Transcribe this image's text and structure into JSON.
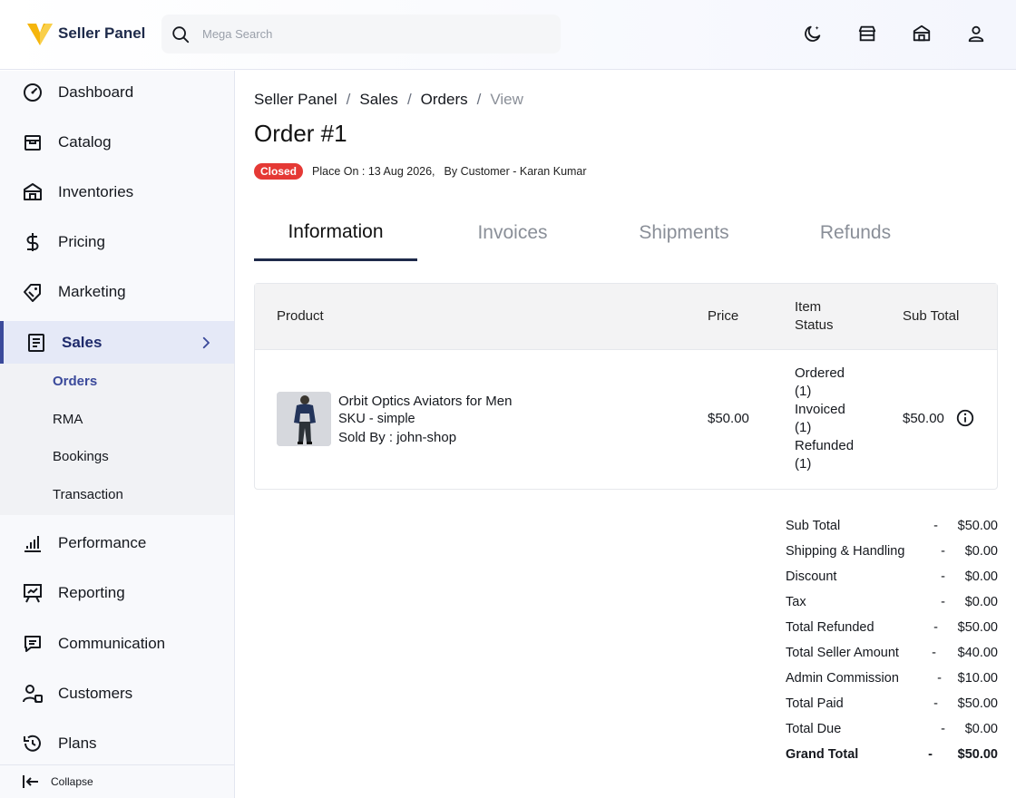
{
  "header": {
    "brand": "Seller Panel",
    "search_placeholder": "Mega Search"
  },
  "sidebar": {
    "items": [
      {
        "label": "Dashboard",
        "icon": "dashboard-icon"
      },
      {
        "label": "Catalog",
        "icon": "catalog-icon"
      },
      {
        "label": "Inventories",
        "icon": "inventories-icon"
      },
      {
        "label": "Pricing",
        "icon": "dollar-icon"
      },
      {
        "label": "Marketing",
        "icon": "tag-icon"
      },
      {
        "label": "Sales",
        "icon": "receipt-icon"
      },
      {
        "label": "Performance",
        "icon": "bar-chart-icon"
      },
      {
        "label": "Reporting",
        "icon": "presentation-icon"
      },
      {
        "label": "Communication",
        "icon": "message-icon"
      },
      {
        "label": "Customers",
        "icon": "customers-icon"
      },
      {
        "label": "Plans",
        "icon": "history-icon"
      }
    ],
    "sales_sub": [
      "Orders",
      "RMA",
      "Bookings",
      "Transaction"
    ],
    "collapse_label": "Collapse"
  },
  "breadcrumb": {
    "items": [
      "Seller Panel",
      "Sales",
      "Orders"
    ],
    "current": "View",
    "separator": "/"
  },
  "order": {
    "title": "Order #1",
    "status": "Closed",
    "placed": "Place On : 13 Aug 2026,",
    "customer": "By Customer - Karan Kumar"
  },
  "tabs": [
    "Information",
    "Invoices",
    "Shipments",
    "Refunds"
  ],
  "table": {
    "headers": {
      "product": "Product",
      "price": "Price",
      "item_status_1": "Item",
      "item_status_2": "Status",
      "subtotal": "Sub Total"
    },
    "rows": [
      {
        "name": "Orbit Optics Aviators for Men",
        "sku": "SKU - simple",
        "sold_by": "Sold By : john-shop",
        "price": "$50.00",
        "status": [
          "Ordered",
          "(1)",
          "Invoiced",
          "(1)",
          "Refunded",
          "(1)"
        ],
        "subtotal": "$50.00"
      }
    ]
  },
  "totals": [
    {
      "label": "Sub Total",
      "dash": "-",
      "value": "$50.00"
    },
    {
      "label": "Shipping & Handling",
      "dash": "-",
      "value": "$0.00"
    },
    {
      "label": "Discount",
      "dash": "-",
      "value": "$0.00"
    },
    {
      "label": "Tax",
      "dash": "-",
      "value": "$0.00"
    },
    {
      "label": "Total Refunded",
      "dash": "-",
      "value": "$50.00"
    },
    {
      "label": "Total Seller Amount",
      "dash": "-",
      "value": "$40.00"
    },
    {
      "label": "Admin Commission",
      "dash": "-",
      "value": "$10.00"
    },
    {
      "label": "Total Paid",
      "dash": "-",
      "value": "$50.00"
    },
    {
      "label": "Total Due",
      "dash": "-",
      "value": "$0.00"
    },
    {
      "label": "Grand Total",
      "dash": "-",
      "value": "$50.00"
    }
  ],
  "colors": {
    "accent": "#3b4a9b",
    "closed_badge": "#e53935",
    "logo_yellow": "#f5b50c",
    "logo_navy": "#1e2a4a"
  }
}
